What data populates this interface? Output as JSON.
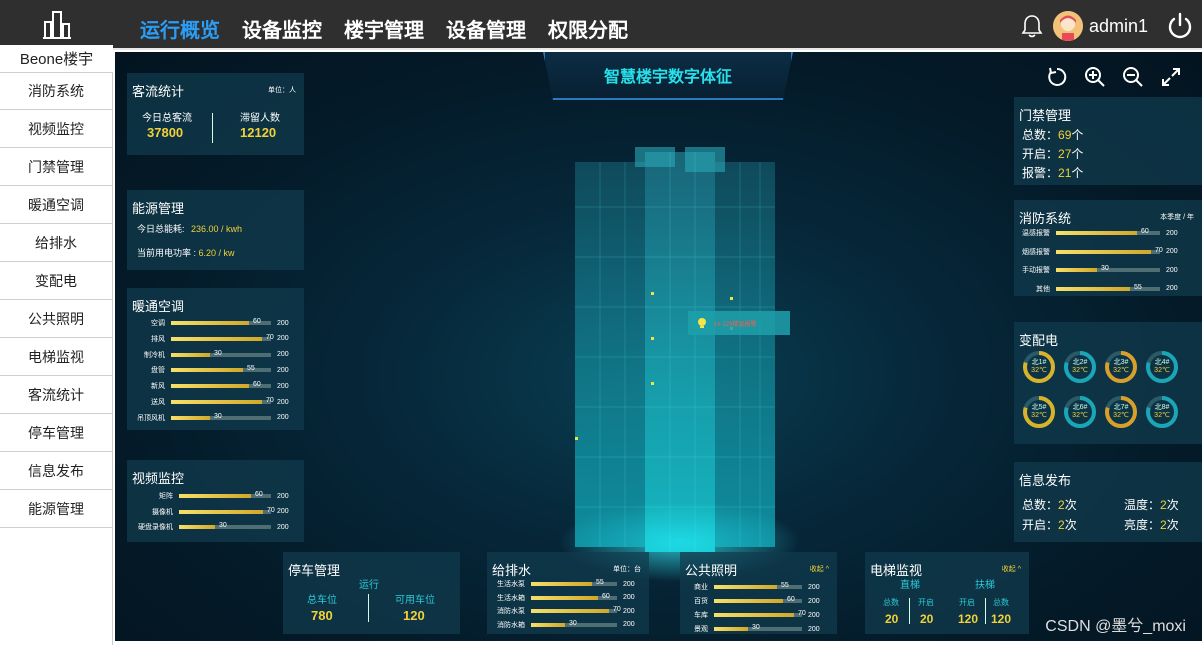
{
  "logo": {
    "text": "Beone楼宇"
  },
  "nav": [
    {
      "label": "运行概览",
      "active": true
    },
    {
      "label": "设备监控"
    },
    {
      "label": "楼宇管理"
    },
    {
      "label": "设备管理"
    },
    {
      "label": "权限分配"
    }
  ],
  "user": {
    "name": "admin1"
  },
  "sidebar": {
    "items": [
      {
        "label": "消防系统"
      },
      {
        "label": "视频监控"
      },
      {
        "label": "门禁管理"
      },
      {
        "label": "暖通空调"
      },
      {
        "label": "给排水"
      },
      {
        "label": "变配电"
      },
      {
        "label": "公共照明"
      },
      {
        "label": "电梯监视"
      },
      {
        "label": "客流统计"
      },
      {
        "label": "停车管理"
      },
      {
        "label": "信息发布"
      },
      {
        "label": "能源管理"
      }
    ]
  },
  "main": {
    "title": "智慧楼宇数字体征"
  },
  "customer": {
    "title": "客流统计",
    "unit": "单位：人",
    "total_label": "今日总客流",
    "total_value": "37800",
    "stay_label": "滞留人数",
    "stay_value": "12120"
  },
  "energy": {
    "title": "能源管理",
    "today_label": "今日总能耗:",
    "today_value": "236.00 / kwh",
    "power_label": "当前用电功率 :",
    "power_value": "6.20 / kw"
  },
  "hvac": {
    "title": "暖通空调",
    "rows": [
      {
        "label": "空调",
        "value": "60",
        "max": "200"
      },
      {
        "label": "排风",
        "value": "70",
        "max": "200"
      },
      {
        "label": "制冷机",
        "value": "30",
        "max": "200"
      },
      {
        "label": "盘管",
        "value": "55",
        "max": "200"
      },
      {
        "label": "新风",
        "value": "60",
        "max": "200"
      },
      {
        "label": "送风",
        "value": "70",
        "max": "200"
      },
      {
        "label": "吊顶风机",
        "value": "30",
        "max": "200"
      }
    ]
  },
  "video": {
    "title": "视频监控",
    "rows": [
      {
        "label": "矩阵",
        "value": "60",
        "max": "200"
      },
      {
        "label": "摄像机",
        "value": "70",
        "max": "200"
      },
      {
        "label": "硬盘录像机",
        "value": "30",
        "max": "200"
      }
    ]
  },
  "parking": {
    "title": "停车管理",
    "status": "运行",
    "total_label": "总车位",
    "total_value": "780",
    "free_label": "可用车位",
    "free_value": "120"
  },
  "water": {
    "title": "给排水",
    "unit": "单位：台",
    "rows": [
      {
        "label": "生活水泵",
        "value": "55",
        "max": "200"
      },
      {
        "label": "生活水箱",
        "value": "60",
        "max": "200"
      },
      {
        "label": "消防水泵",
        "value": "70",
        "max": "200"
      },
      {
        "label": "消防水箱",
        "value": "30",
        "max": "200"
      }
    ]
  },
  "lighting": {
    "title": "公共照明",
    "collapse": "收起 ^",
    "rows": [
      {
        "label": "商业",
        "value": "55",
        "max": "200"
      },
      {
        "label": "百货",
        "value": "60",
        "max": "200"
      },
      {
        "label": "车库",
        "value": "70",
        "max": "200"
      },
      {
        "label": "景观",
        "value": "30",
        "max": "200"
      }
    ]
  },
  "elevator": {
    "title": "电梯监视",
    "collapse": "收起 ^",
    "group1": "直梯",
    "group2": "扶梯",
    "cols": [
      {
        "label": "总数",
        "value": "20"
      },
      {
        "label": "开启",
        "value": "20"
      },
      {
        "label": "开启",
        "value": "120"
      },
      {
        "label": "总数",
        "value": "120"
      }
    ]
  },
  "access": {
    "title": "门禁管理",
    "lines": [
      {
        "label": "总数：",
        "value": "69",
        "unit": "个"
      },
      {
        "label": "开启：",
        "value": "27",
        "unit": "个"
      },
      {
        "label": "报警：",
        "value": "21",
        "unit": "个"
      }
    ]
  },
  "fire": {
    "title": "消防系统",
    "unit": "本季度 / 年",
    "rows": [
      {
        "label": "温感报警",
        "value": "60",
        "max": "200"
      },
      {
        "label": "烟感报警",
        "value": "70",
        "max": "200"
      },
      {
        "label": "手动报警",
        "value": "30",
        "max": "200"
      },
      {
        "label": "其他",
        "value": "55",
        "max": "200"
      }
    ]
  },
  "power": {
    "title": "变配电",
    "gauges": [
      {
        "name": "北1#",
        "temp": "32℃",
        "color": "#d8b22a"
      },
      {
        "name": "北2#",
        "temp": "32℃",
        "color": "#1aa6b7"
      },
      {
        "name": "北3#",
        "temp": "32℃",
        "color": "#d8a02a"
      },
      {
        "name": "北4#",
        "temp": "32℃",
        "color": "#1aa6b7"
      },
      {
        "name": "北5#",
        "temp": "32℃",
        "color": "#d8b22a"
      },
      {
        "name": "北6#",
        "temp": "32℃",
        "color": "#1aa6b7"
      },
      {
        "name": "北7#",
        "temp": "32℃",
        "color": "#d8a02a"
      },
      {
        "name": "北8#",
        "temp": "32℃",
        "color": "#1aa6b7"
      }
    ]
  },
  "info": {
    "title": "信息发布",
    "total_label": "总数：",
    "total_value": "2",
    "open_label": "开启：",
    "open_value": "2",
    "temp_label": "温度：",
    "temp_value": "2",
    "bright_label": "亮度：",
    "bright_value": "2",
    "unit": "次"
  },
  "alert": {
    "text": "1# 123楼层报警"
  },
  "watermark": "CSDN @墨兮_moxi",
  "icons": [
    "building-logo-icon",
    "bell-icon",
    "avatar-icon",
    "power-icon",
    "rotate-icon",
    "zoom-in-icon",
    "zoom-out-icon",
    "fullscreen-icon",
    "lightbulb-icon"
  ]
}
